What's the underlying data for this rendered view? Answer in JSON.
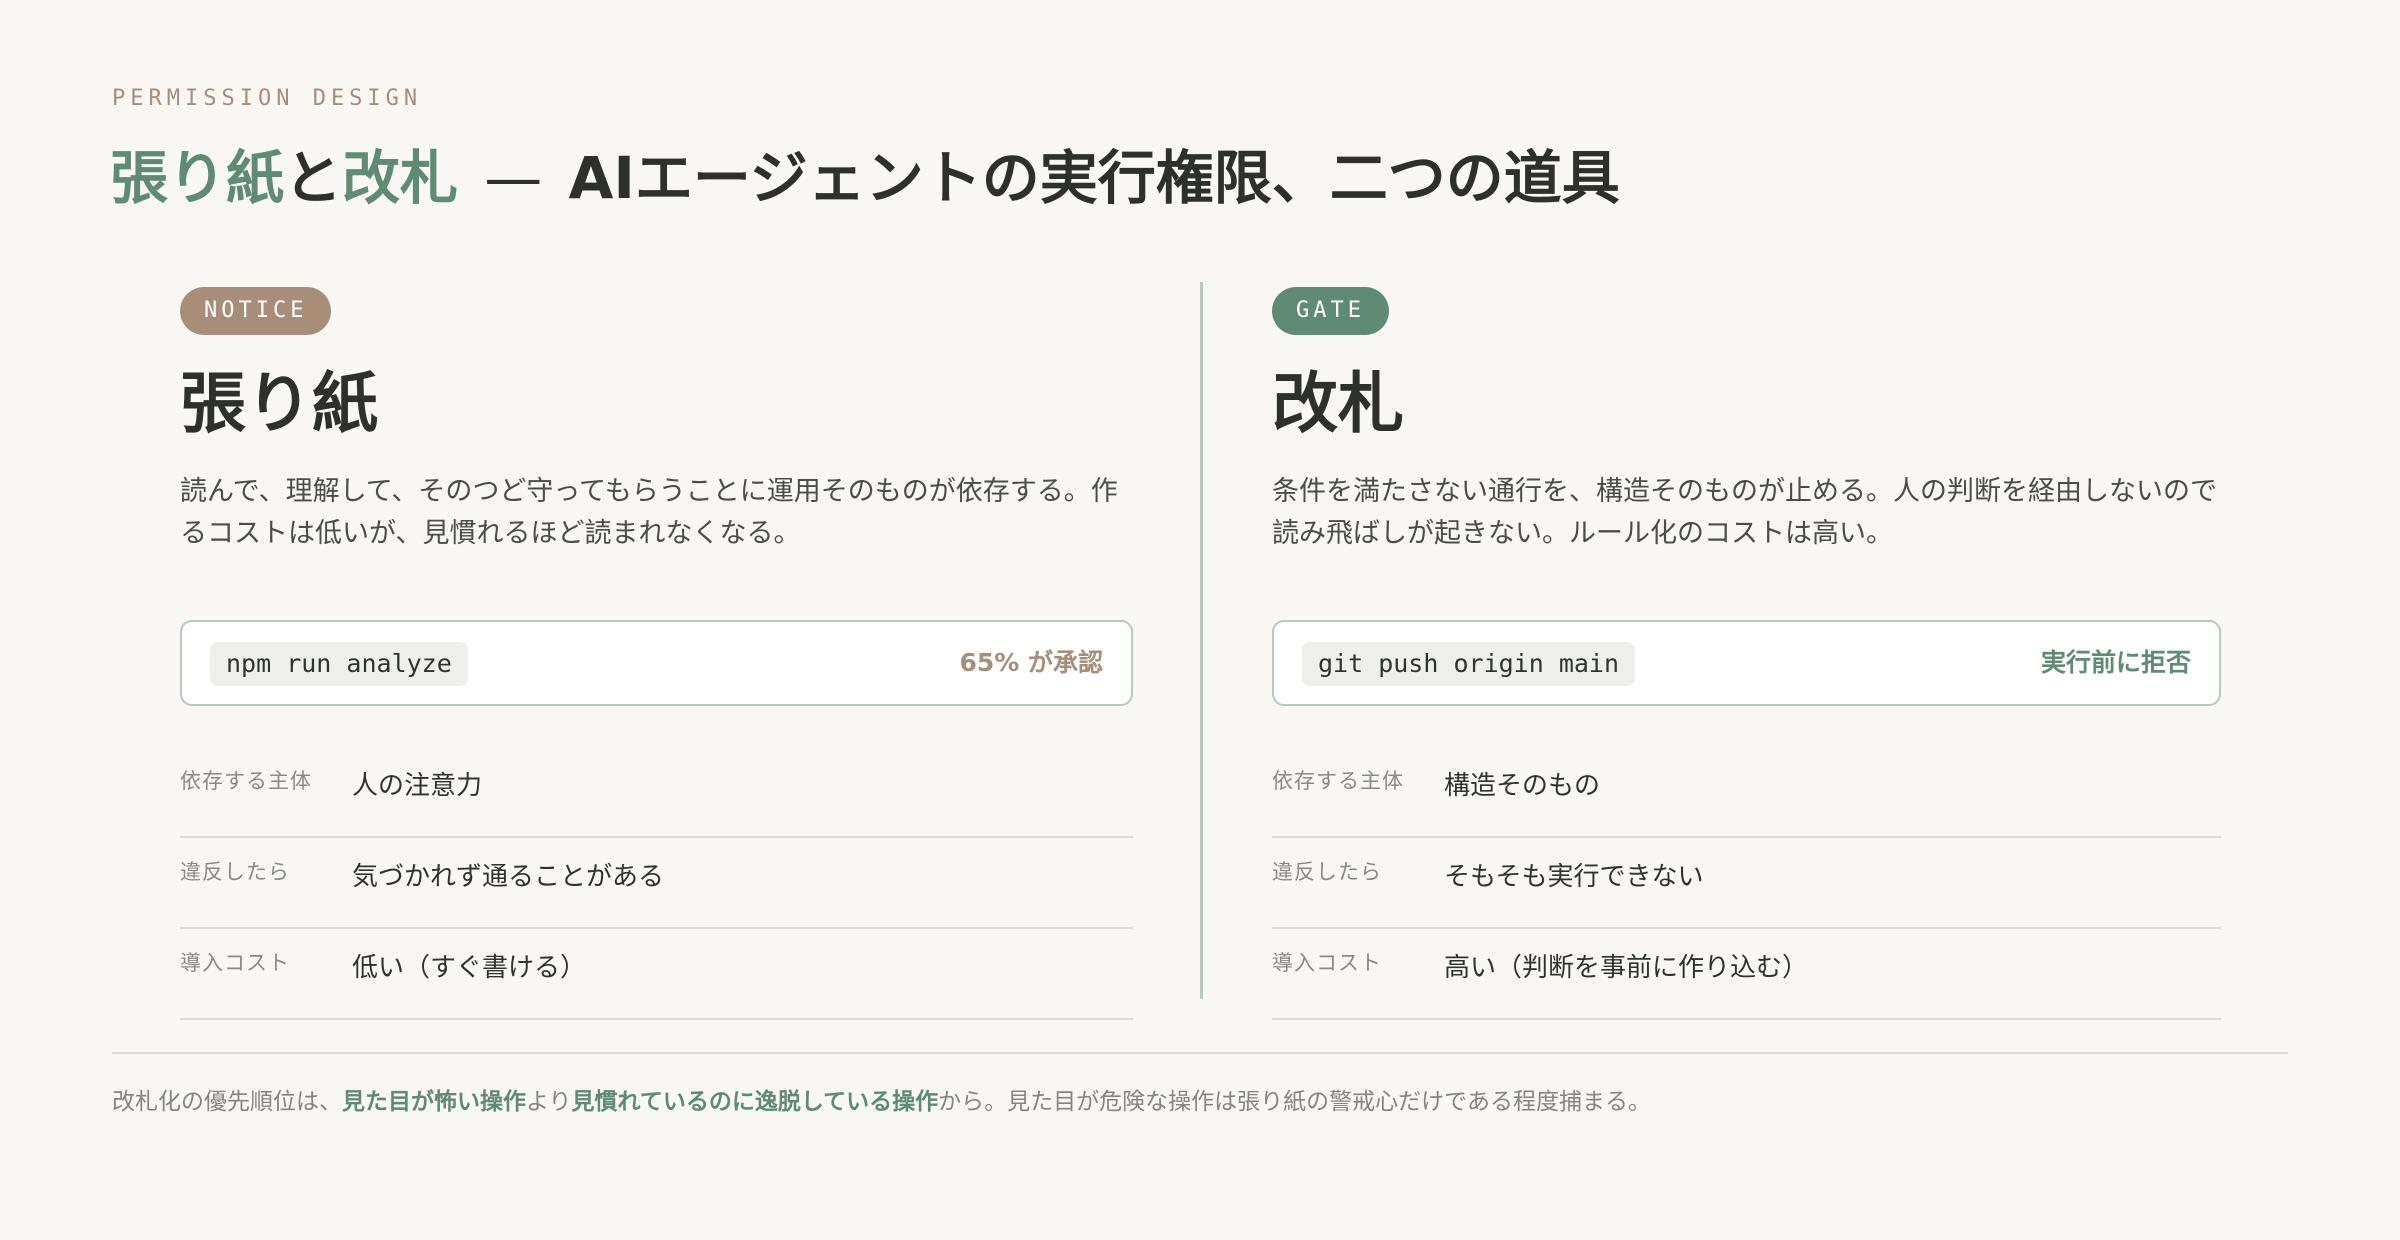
{
  "eyebrow": "PERMISSION DESIGN",
  "title": {
    "part1": "張り紙",
    "part2": "と",
    "part3": "改札",
    "dash": "—",
    "part4": "AIエージェントの実行権限、二つの道具"
  },
  "panels": [
    {
      "badge": "NOTICE",
      "title": "張り紙",
      "description": "読んで、理解して、そのつど守ってもらうことに運用そのものが依存する。作るコストは低いが、見慣れるほど読まれなくなる。",
      "command": "npm run analyze",
      "result": "65% が承認",
      "rows": [
        {
          "label": "依存する主体",
          "value": "人の注意力"
        },
        {
          "label": "違反したら",
          "value": "気づかれず通ることがある"
        },
        {
          "label": "導入コスト",
          "value": "低い（すぐ書ける）"
        }
      ]
    },
    {
      "badge": "GATE",
      "title": "改札",
      "description": "条件を満たさない通行を、構造そのものが止める。人の判断を経由しないので読み飛ばしが起きない。ルール化のコストは高い。",
      "command": "git push origin main",
      "result": "実行前に拒否",
      "rows": [
        {
          "label": "依存する主体",
          "value": "構造そのもの"
        },
        {
          "label": "違反したら",
          "value": "そもそも実行できない"
        },
        {
          "label": "導入コスト",
          "value": "高い（判断を事前に作り込む）"
        }
      ]
    }
  ],
  "footer": {
    "p1": "改札化の優先順位は、",
    "h1": "見た目が怖い操作",
    "p2": "より",
    "h2": "見慣れているのに逸脱している操作",
    "p3": "から。見た目が危険な操作は張り紙の警戒心だけである程度捕まる。"
  },
  "colors": {
    "green_accent": "#5f8a74",
    "brown_accent": "#a88e79",
    "background": "#f9f7f3",
    "text": "#2f3330"
  }
}
